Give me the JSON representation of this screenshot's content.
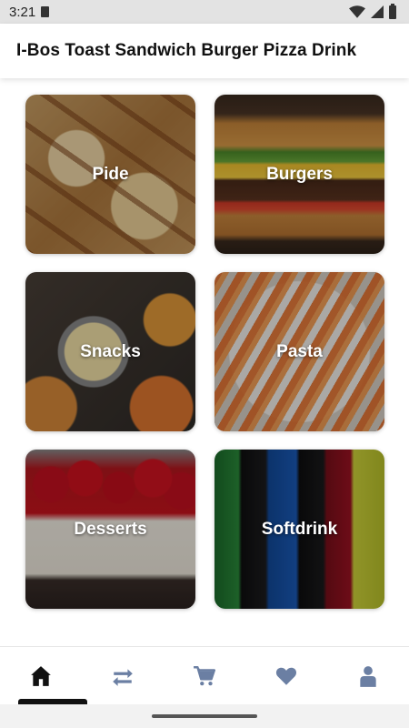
{
  "status_bar": {
    "time": "3:21"
  },
  "header": {
    "title": "I-Bos Toast Sandwich Burger Pizza Drink"
  },
  "categories": [
    {
      "label": "Pide",
      "image": "pide-photo"
    },
    {
      "label": "Burgers",
      "image": "burger-photo"
    },
    {
      "label": "Snacks",
      "image": "snacks-photo"
    },
    {
      "label": "Pasta",
      "image": "pasta-photo"
    },
    {
      "label": "Desserts",
      "image": "cheesecake-photo"
    },
    {
      "label": "Softdrink",
      "image": "soda-bottles-photo"
    }
  ],
  "bottom_nav": {
    "items": [
      {
        "icon": "home-icon",
        "active": true
      },
      {
        "icon": "swap-arrows-icon",
        "active": false
      },
      {
        "icon": "cart-icon",
        "active": false
      },
      {
        "icon": "heart-icon",
        "active": false
      },
      {
        "icon": "person-icon",
        "active": false
      }
    ],
    "active_color": "#111111",
    "inactive_color": "#6b7fa3"
  }
}
